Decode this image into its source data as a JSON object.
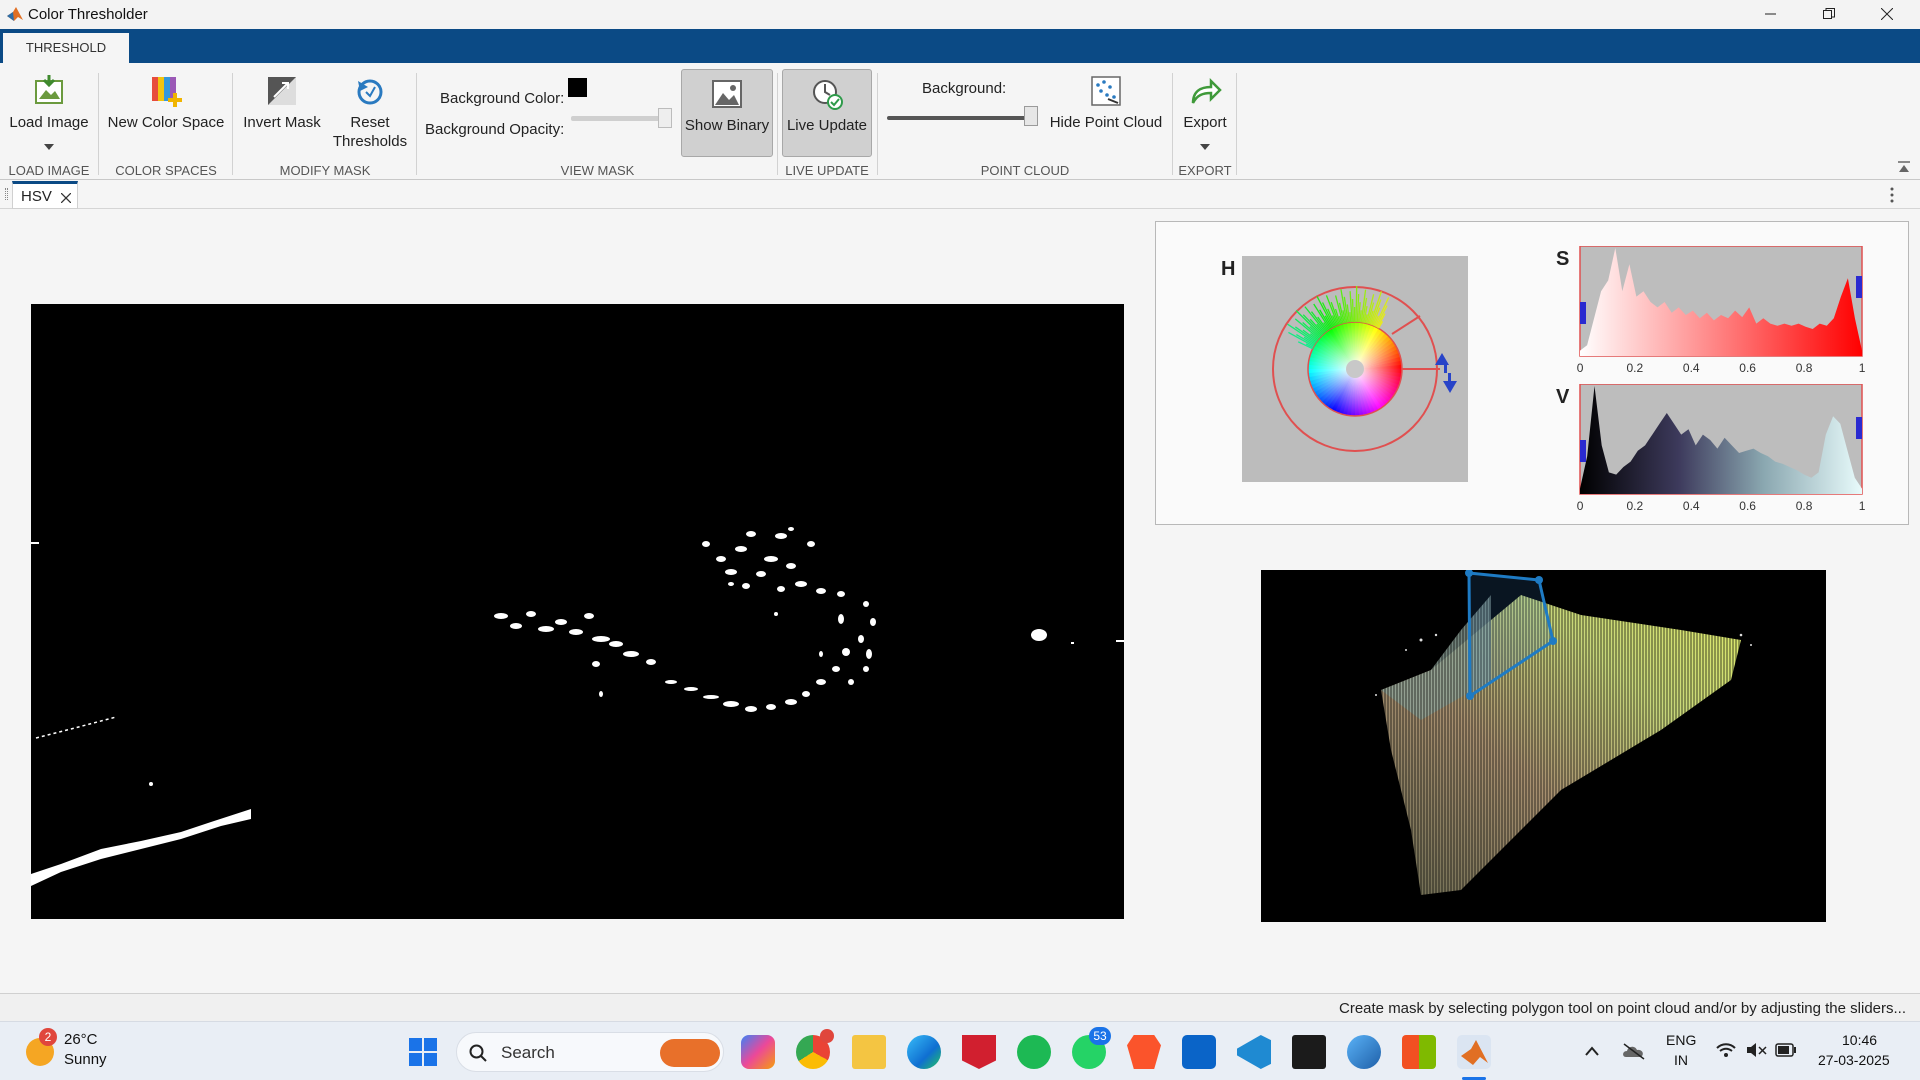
{
  "window": {
    "title": "Color Thresholder"
  },
  "ribbon": {
    "tab": "THRESHOLD",
    "buttons": {
      "load_image": "Load Image",
      "new_color_space": "New Color Space",
      "invert_mask": "Invert Mask",
      "reset_thresholds_1": "Reset",
      "reset_thresholds_2": "Thresholds",
      "show_binary": "Show Binary",
      "live_update": "Live Update",
      "hide_point_cloud": "Hide Point Cloud",
      "export": "Export"
    },
    "labels": {
      "background_color": "Background Color:",
      "background_opacity": "Background Opacity:",
      "background": "Background:"
    },
    "groups": {
      "load_image": "LOAD IMAGE",
      "color_spaces": "COLOR SPACES",
      "modify_mask": "MODIFY MASK",
      "view_mask": "VIEW MASK",
      "live_update": "LIVE UPDATE",
      "point_cloud": "POINT CLOUD",
      "export": "EXPORT"
    },
    "background_color": "#000000",
    "background_opacity": 1.0,
    "point_cloud_background": 1.0
  },
  "document_tab": {
    "label": "HSV"
  },
  "histograms": {
    "h_label": "H",
    "s_label": "S",
    "v_label": "V",
    "ticks": [
      "0",
      "0.2",
      "0.4",
      "0.6",
      "0.8",
      "1"
    ]
  },
  "status": {
    "message": "Create mask by selecting polygon tool on point cloud and/or by adjusting the sliders..."
  },
  "taskbar": {
    "weather_temp": "26°C",
    "weather_desc": "Sunny",
    "weather_badge": "2",
    "search_label": "Search",
    "whatsapp_badge": "53",
    "lang_1": "ENG",
    "lang_2": "IN",
    "time": "10:46",
    "date": "27-03-2025"
  },
  "colors": {
    "ribbon_blue": "#0b4a85",
    "polygon": "#1e7bc4",
    "histogram_outline": "#e05050"
  }
}
